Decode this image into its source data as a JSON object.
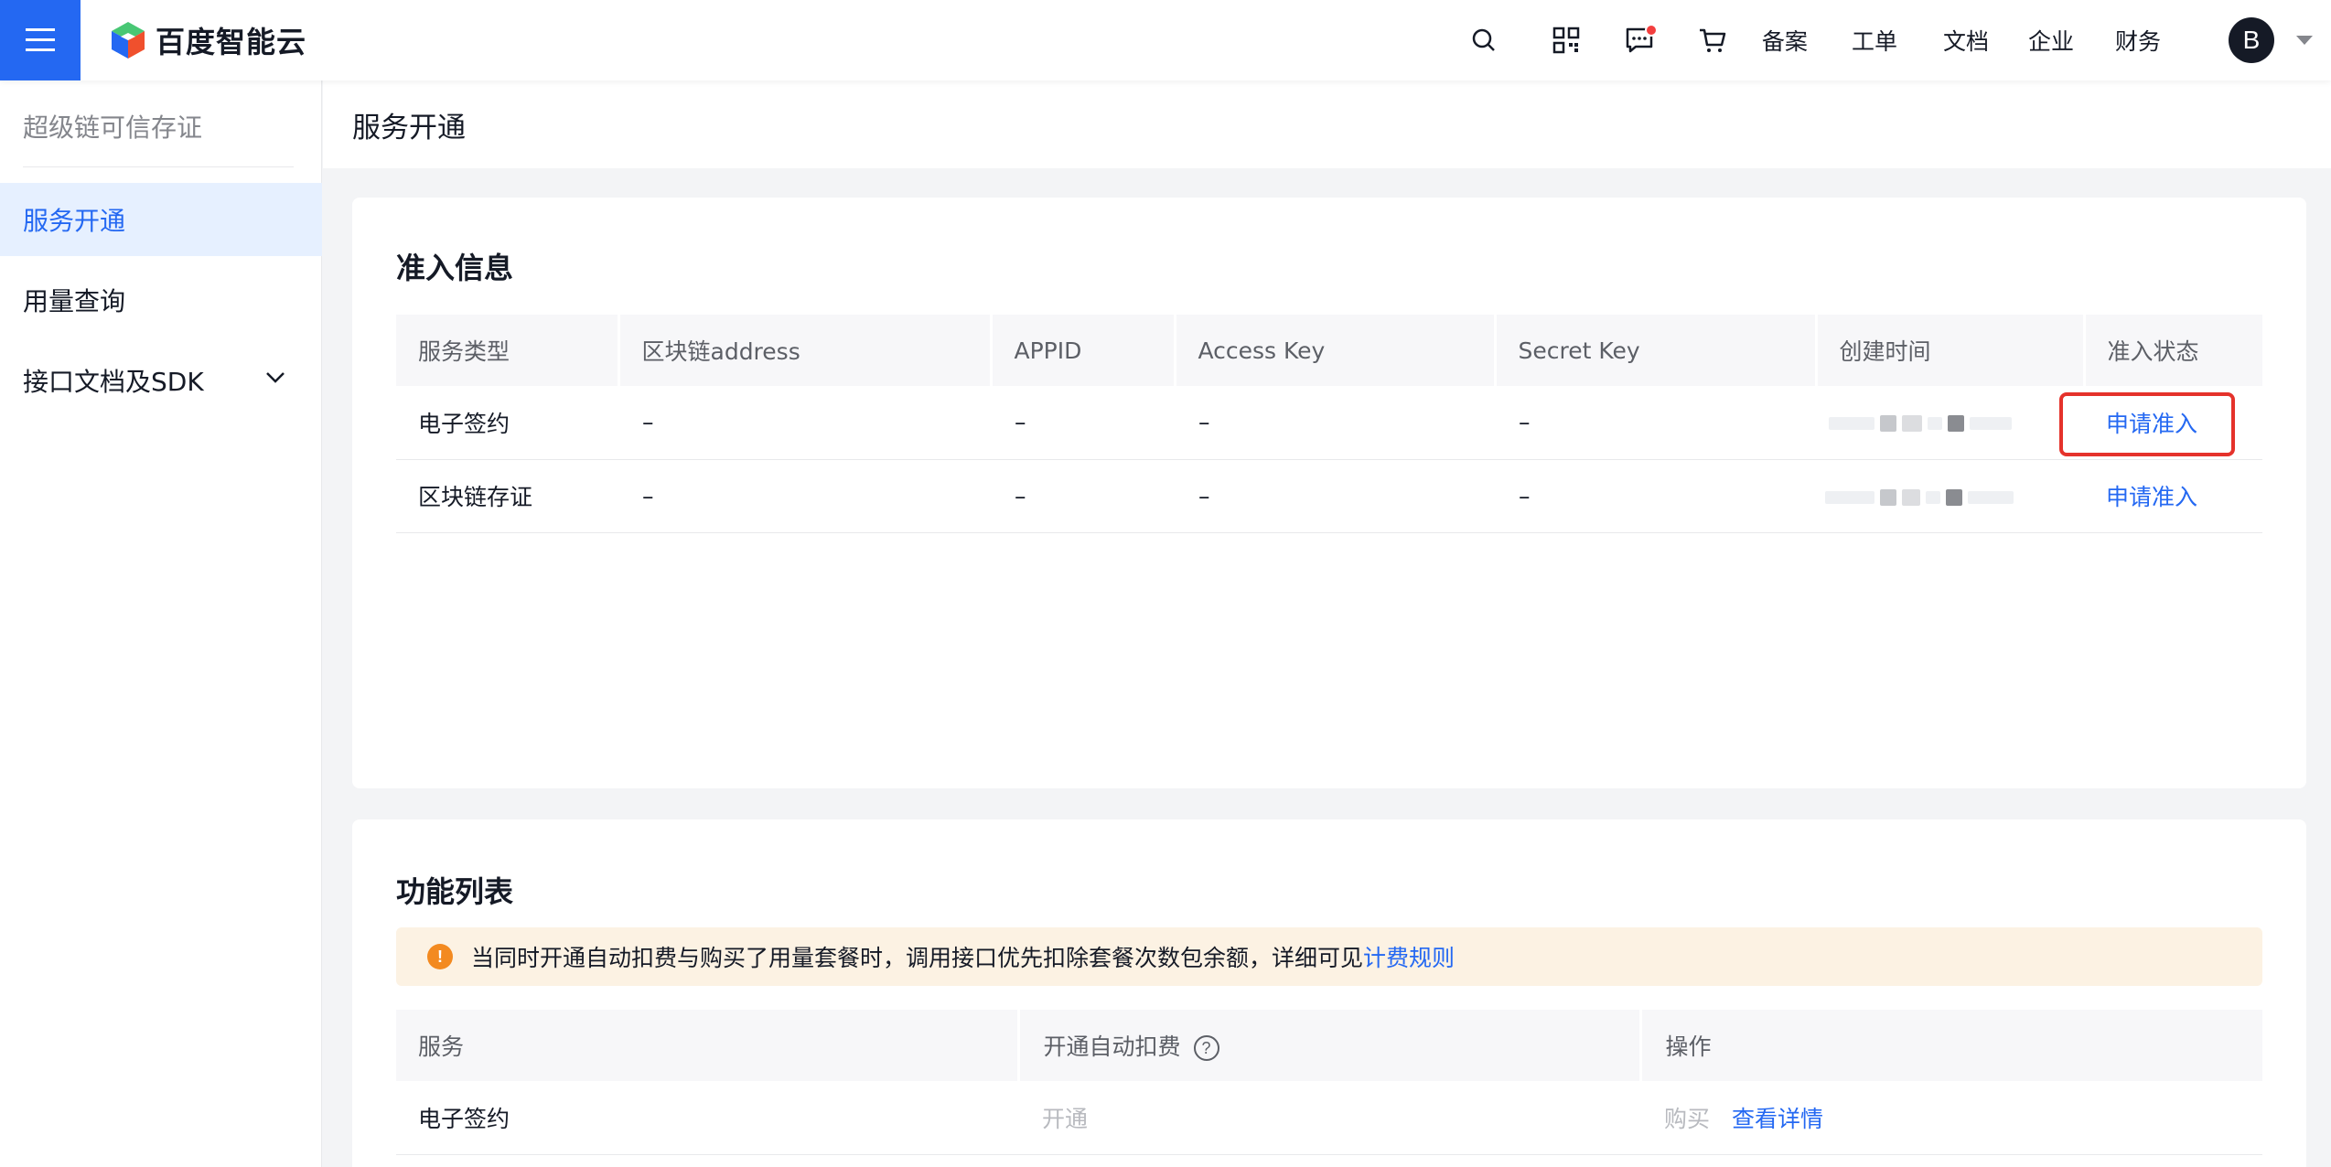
{
  "header": {
    "logo_text": "百度智能云",
    "nav_links": [
      "备案",
      "工单",
      "文档",
      "企业",
      "财务"
    ],
    "avatar_letter": "B"
  },
  "sidebar": {
    "title": "超级链可信存证",
    "items": [
      {
        "label": "服务开通",
        "active": true
      },
      {
        "label": "用量查询",
        "active": false
      },
      {
        "label": "接口文档及SDK",
        "active": false
      }
    ]
  },
  "page": {
    "title": "服务开通"
  },
  "access_info": {
    "title": "准入信息",
    "columns": [
      "服务类型",
      "区块链address",
      "APPID",
      "Access Key",
      "Secret Key",
      "创建时间",
      "准入状态"
    ],
    "rows": [
      {
        "type": "电子签约",
        "address": "–",
        "appid": "–",
        "access_key": "–",
        "secret_key": "–",
        "status": "申请准入"
      },
      {
        "type": "区块链存证",
        "address": "–",
        "appid": "–",
        "access_key": "–",
        "secret_key": "–",
        "status": "申请准入"
      }
    ]
  },
  "feature_list": {
    "title": "功能列表",
    "notice_text": "当同时开通自动扣费与购买了用量套餐时，调用接口优先扣除套餐次数包余额，详细可见",
    "notice_link": "计费规则",
    "notice_icon": "!",
    "columns": [
      "服务",
      "开通自动扣费",
      "操作"
    ],
    "help_icon": "?",
    "rows": [
      {
        "service": "电子签约",
        "auto_pay": "开通",
        "buy": "购买",
        "detail": "查看详情"
      }
    ]
  },
  "colors": {
    "accent": "#2468f2",
    "highlight": "#e5322b",
    "warning": "#f38a20"
  }
}
